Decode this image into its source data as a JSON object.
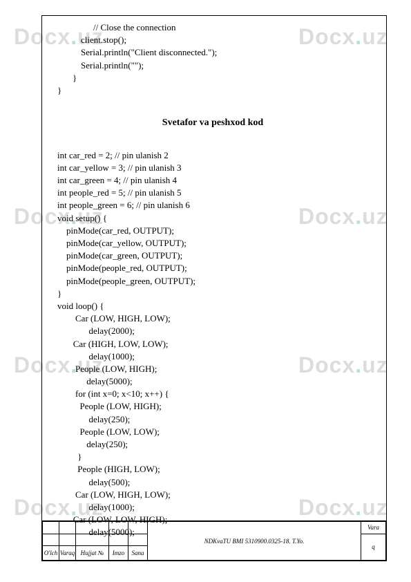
{
  "watermark": {
    "text1": "Docx",
    "dot": ".",
    "text2": "uz"
  },
  "code_top": [
    {
      "cls": "indent3",
      "text": "// Close the connection"
    },
    {
      "cls": "indent2",
      "text": "client.stop();"
    },
    {
      "cls": "indent2",
      "text": "Serial.println(\"Client disconnected.\");"
    },
    {
      "cls": "indent2",
      "text": "Serial.println(\"\");"
    },
    {
      "cls": "indent1",
      "text": "}"
    },
    {
      "cls": "",
      "text": "}"
    }
  ],
  "heading": "Svetafor va peshxod kod",
  "code_main": [
    "int car_red = 2; // pin ulanish 2",
    "int car_yellow = 3; // pin ulanish 3",
    "int car_green = 4; // pin ulanish 4",
    "int people_red = 5; // pin ulanish 5",
    "int people_green = 6; // pin ulanish 6",
    "void setup() {",
    "    pinMode(car_red, OUTPUT);",
    "    pinMode(car_yellow, OUTPUT);",
    "    pinMode(car_green, OUTPUT);",
    "    pinMode(people_red, OUTPUT);",
    "    pinMode(people_green, OUTPUT);",
    "}",
    "void loop() {",
    "        Car (LOW, HIGH, LOW);",
    "              delay(2000);",
    "       Car (HIGH, LOW, LOW);",
    "              delay(1000);",
    "        People (LOW, HIGH);",
    "             delay(5000);",
    "        for (int x=0; x<10; x++) {",
    "          People (LOW, HIGH);",
    "              delay(250);",
    "          People (LOW, LOW);",
    "             delay(250);",
    "         }",
    "         People (HIGH, LOW);",
    "              delay(500);",
    "        Car (LOW, HIGH, LOW);",
    "              delay(1000);",
    "       Car (LOW, LOW, HIGH);",
    "              delay(5000);"
  ],
  "title_block": {
    "doc_code": "NDKvaTU BMI 5310900.0325-18. T.Yo.",
    "vara": "Vara",
    "q": "q",
    "headers": [
      "O'lch",
      "Varaq",
      "Hujjat №",
      "Imzo",
      "Sana"
    ]
  }
}
